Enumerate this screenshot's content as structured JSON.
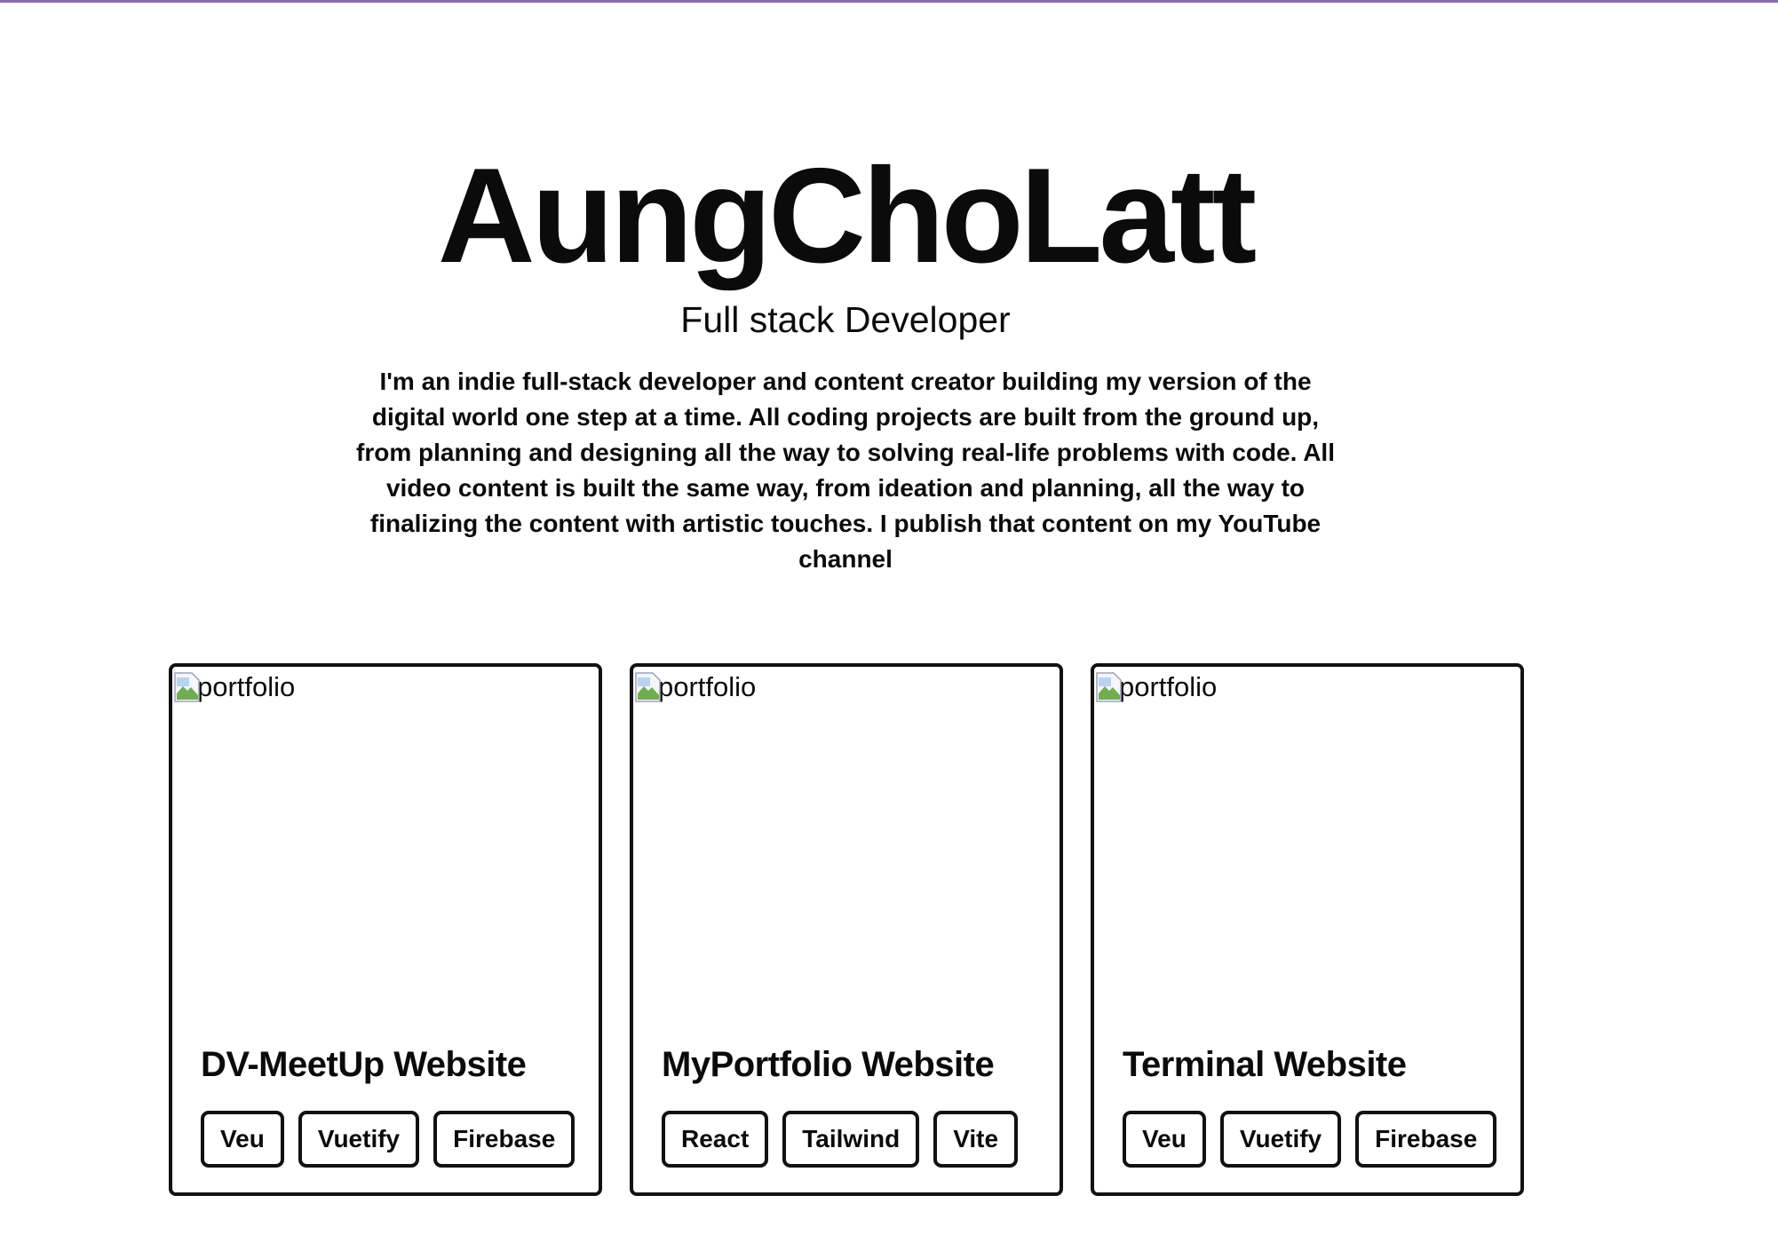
{
  "hero": {
    "name": "AungChoLatt",
    "role": "Full stack Developer",
    "bio": "I'm an indie full-stack developer and content creator building my version of the digital world one step at a time. All coding projects are built from the ground up, from planning and designing all the way to solving real-life problems with code. All video content is built the same way, from ideation and planning, all the way to finalizing the content with artistic touches. I publish that content on my YouTube channel"
  },
  "projects": [
    {
      "image_alt": "portfolio",
      "title": "DV-MeetUp Website",
      "tags": [
        "Veu",
        "Vuetify",
        "Firebase"
      ]
    },
    {
      "image_alt": "portfolio",
      "title": "MyPortfolio Website",
      "tags": [
        "React",
        "Tailwind",
        "Vite"
      ]
    },
    {
      "image_alt": "portfolio",
      "title": "Terminal Website",
      "tags": [
        "Veu",
        "Vuetify",
        "Firebase"
      ]
    }
  ],
  "icons": {
    "broken_image": "broken-image-icon"
  },
  "colors": {
    "accent_line": "#8a6bb0",
    "text": "#0b0b0b",
    "border": "#111111"
  }
}
